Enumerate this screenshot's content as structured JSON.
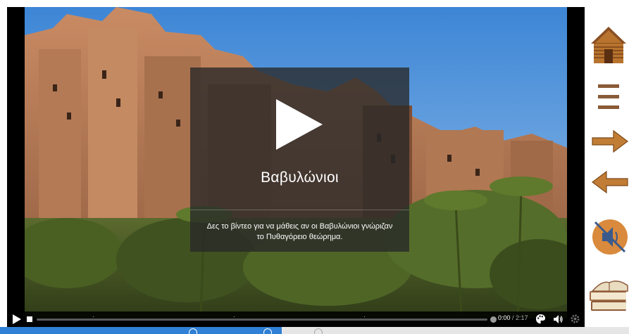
{
  "video": {
    "title": "Βαβυλώνιοι",
    "description": "Δες το βίντεο για να μάθεις αν οι Βαβυλώνιοι γνώριζαν το Πυθαγόρειο θεώρημα."
  },
  "controls": {
    "current_time": "0:00",
    "separator": " / ",
    "duration": "2:17",
    "progress_fraction": 0
  },
  "nav": {
    "items": [
      {
        "icon": "home-cabin-icon"
      },
      {
        "icon": "menu-icon"
      },
      {
        "icon": "next-arrow-icon"
      },
      {
        "icon": "previous-arrow-icon"
      },
      {
        "icon": "sound-muted-icon"
      },
      {
        "icon": "books-icon"
      }
    ]
  },
  "colors": {
    "accent_blue": "#2f80d6",
    "overlay_bg": "#282828",
    "wood": "#b8742e"
  }
}
